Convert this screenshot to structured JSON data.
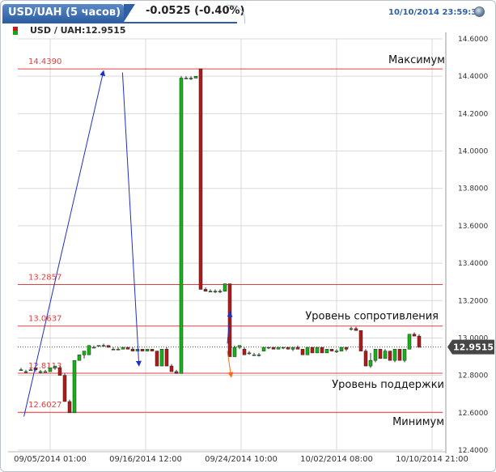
{
  "header": {
    "tab_title": "USD/UAH (5 часов)",
    "change": "-0.0525 (-0.40%)",
    "datetime": "10/10/2014 23:59:35"
  },
  "chart_data": {
    "type": "candlestick",
    "instrument_label": "USD / UAH:12.9515",
    "last_price": 12.9515,
    "last_price_label": "12.9515",
    "ylim": [
      12.4,
      14.6
    ],
    "y_ticks": [
      "14.6000",
      "14.4000",
      "14.2000",
      "14.0000",
      "13.8000",
      "13.6000",
      "13.4000",
      "13.2000",
      "13.0000",
      "12.8000",
      "12.6000",
      "12.4000"
    ],
    "x_ticks": [
      "09/05/2014 01:00",
      "09/16/2014 12:00",
      "09/24/2014 10:00",
      "10/02/2014 08:00",
      "10/10/2014 21:00"
    ],
    "levels": [
      {
        "value": 14.439,
        "label": "14.4390"
      },
      {
        "value": 13.2857,
        "label": "13.2857"
      },
      {
        "value": 13.0637,
        "label": "13.0637"
      },
      {
        "value": 12.8113,
        "label": "12.8113"
      },
      {
        "value": 12.6027,
        "label": "12.6027"
      }
    ],
    "annotations": {
      "max": "Максимум",
      "resistance": "Уровень сопротивления",
      "support": "Уровень поддержки",
      "min": "Минимум"
    },
    "candles": [
      {
        "o": 12.83,
        "h": 12.84,
        "l": 12.83,
        "c": 12.83
      },
      {
        "o": 12.82,
        "h": 12.83,
        "l": 12.81,
        "c": 12.82
      },
      {
        "o": 12.83,
        "h": 12.84,
        "l": 12.83,
        "c": 12.83
      },
      {
        "o": 12.84,
        "h": 12.84,
        "l": 12.82,
        "c": 12.83
      },
      {
        "o": 12.82,
        "h": 12.83,
        "l": 12.81,
        "c": 12.82
      },
      {
        "o": 12.82,
        "h": 12.83,
        "l": 12.82,
        "c": 12.82
      },
      {
        "o": 12.82,
        "h": 12.84,
        "l": 12.82,
        "c": 12.84
      },
      {
        "o": 12.84,
        "h": 12.85,
        "l": 12.83,
        "c": 12.85
      },
      {
        "o": 12.84,
        "h": 12.85,
        "l": 12.8,
        "c": 12.8
      },
      {
        "o": 12.8,
        "h": 12.81,
        "l": 12.66,
        "c": 12.66
      },
      {
        "o": 12.66,
        "h": 12.67,
        "l": 12.6,
        "c": 12.6
      },
      {
        "o": 12.6,
        "h": 12.88,
        "l": 12.6,
        "c": 12.88
      },
      {
        "o": 12.88,
        "h": 12.91,
        "l": 12.88,
        "c": 12.91
      },
      {
        "o": 12.91,
        "h": 12.93,
        "l": 12.89,
        "c": 12.93
      },
      {
        "o": 12.91,
        "h": 12.96,
        "l": 12.91,
        "c": 12.96
      },
      {
        "o": 12.95,
        "h": 12.96,
        "l": 12.95,
        "c": 12.95
      },
      {
        "o": 12.96,
        "h": 12.96,
        "l": 12.96,
        "c": 12.96
      },
      {
        "o": 12.96,
        "h": 12.97,
        "l": 12.96,
        "c": 12.96
      },
      {
        "o": 12.96,
        "h": 12.96,
        "l": 12.95,
        "c": 12.95
      },
      {
        "o": 12.94,
        "h": 12.95,
        "l": 12.94,
        "c": 12.94
      },
      {
        "o": 12.94,
        "h": 12.95,
        "l": 12.94,
        "c": 12.94
      },
      {
        "o": 12.94,
        "h": 12.95,
        "l": 12.94,
        "c": 12.95
      },
      {
        "o": 12.95,
        "h": 12.95,
        "l": 12.94,
        "c": 12.94
      },
      {
        "o": 12.94,
        "h": 12.95,
        "l": 12.93,
        "c": 12.93
      },
      {
        "o": 12.93,
        "h": 12.94,
        "l": 12.93,
        "c": 12.94
      },
      {
        "o": 12.94,
        "h": 12.94,
        "l": 12.93,
        "c": 12.93
      },
      {
        "o": 12.93,
        "h": 12.94,
        "l": 12.93,
        "c": 12.94
      },
      {
        "o": 12.94,
        "h": 12.94,
        "l": 12.93,
        "c": 12.93
      },
      {
        "o": 12.93,
        "h": 12.93,
        "l": 12.85,
        "c": 12.85
      },
      {
        "o": 12.85,
        "h": 12.94,
        "l": 12.85,
        "c": 12.94
      },
      {
        "o": 12.94,
        "h": 12.95,
        "l": 12.85,
        "c": 12.85
      },
      {
        "o": 12.85,
        "h": 12.86,
        "l": 12.82,
        "c": 12.82
      },
      {
        "o": 12.82,
        "h": 12.83,
        "l": 12.81,
        "c": 12.81
      },
      {
        "o": 12.81,
        "h": 14.4,
        "l": 12.81,
        "c": 14.39
      },
      {
        "o": 14.39,
        "h": 14.4,
        "l": 14.39,
        "c": 14.39
      },
      {
        "o": 14.39,
        "h": 14.4,
        "l": 14.38,
        "c": 14.39
      },
      {
        "o": 14.39,
        "h": 14.4,
        "l": 14.39,
        "c": 14.4
      },
      {
        "o": 14.44,
        "h": 14.44,
        "l": 13.26,
        "c": 13.26
      },
      {
        "o": 13.26,
        "h": 13.27,
        "l": 13.25,
        "c": 13.25
      },
      {
        "o": 13.25,
        "h": 13.26,
        "l": 13.25,
        "c": 13.25
      },
      {
        "o": 13.25,
        "h": 13.26,
        "l": 13.24,
        "c": 13.25
      },
      {
        "o": 13.25,
        "h": 13.26,
        "l": 13.24,
        "c": 13.25
      },
      {
        "o": 13.25,
        "h": 13.29,
        "l": 13.25,
        "c": 13.29
      },
      {
        "o": 13.29,
        "h": 13.29,
        "l": 12.9,
        "c": 12.9
      },
      {
        "o": 12.9,
        "h": 12.96,
        "l": 12.9,
        "c": 12.95
      },
      {
        "o": 12.95,
        "h": 12.96,
        "l": 12.94,
        "c": 12.96
      },
      {
        "o": 12.94,
        "h": 12.95,
        "l": 12.91,
        "c": 12.91
      },
      {
        "o": 12.92,
        "h": 12.93,
        "l": 12.91,
        "c": 12.92
      },
      {
        "o": 12.91,
        "h": 12.92,
        "l": 12.91,
        "c": 12.91
      },
      {
        "o": 12.91,
        "h": 12.92,
        "l": 12.9,
        "c": 12.91
      },
      {
        "o": 12.93,
        "h": 12.95,
        "l": 12.93,
        "c": 12.95
      },
      {
        "o": 12.95,
        "h": 12.95,
        "l": 12.94,
        "c": 12.95
      },
      {
        "o": 12.95,
        "h": 12.95,
        "l": 12.94,
        "c": 12.94
      },
      {
        "o": 12.94,
        "h": 12.95,
        "l": 12.94,
        "c": 12.95
      },
      {
        "o": 12.95,
        "h": 12.95,
        "l": 12.94,
        "c": 12.95
      },
      {
        "o": 12.95,
        "h": 12.95,
        "l": 12.94,
        "c": 12.94
      },
      {
        "o": 12.94,
        "h": 12.95,
        "l": 12.93,
        "c": 12.95
      },
      {
        "o": 12.95,
        "h": 12.96,
        "l": 12.94,
        "c": 12.94
      },
      {
        "o": 12.94,
        "h": 12.94,
        "l": 12.91,
        "c": 12.91
      },
      {
        "o": 12.91,
        "h": 12.95,
        "l": 12.91,
        "c": 12.95
      },
      {
        "o": 12.95,
        "h": 12.95,
        "l": 12.92,
        "c": 12.92
      },
      {
        "o": 12.92,
        "h": 12.95,
        "l": 12.92,
        "c": 12.95
      },
      {
        "o": 12.95,
        "h": 12.95,
        "l": 12.92,
        "c": 12.92
      },
      {
        "o": 12.92,
        "h": 12.94,
        "l": 12.92,
        "c": 12.94
      },
      {
        "o": 12.94,
        "h": 12.94,
        "l": 12.93,
        "c": 12.93
      },
      {
        "o": 12.93,
        "h": 12.94,
        "l": 12.92,
        "c": 12.93
      },
      {
        "o": 12.93,
        "h": 12.95,
        "l": 12.93,
        "c": 12.95
      },
      {
        "o": 12.95,
        "h": 12.95,
        "l": 12.93,
        "c": 12.94
      },
      {
        "o": 13.05,
        "h": 13.06,
        "l": 13.04,
        "c": 13.05
      },
      {
        "o": 13.05,
        "h": 13.06,
        "l": 13.04,
        "c": 13.04
      },
      {
        "o": 13.04,
        "h": 13.04,
        "l": 12.93,
        "c": 12.93
      },
      {
        "o": 12.93,
        "h": 12.94,
        "l": 12.85,
        "c": 12.85
      },
      {
        "o": 12.85,
        "h": 12.92,
        "l": 12.84,
        "c": 12.88
      },
      {
        "o": 12.88,
        "h": 12.94,
        "l": 12.87,
        "c": 12.94
      },
      {
        "o": 12.94,
        "h": 12.94,
        "l": 12.89,
        "c": 12.89
      },
      {
        "o": 12.89,
        "h": 12.94,
        "l": 12.89,
        "c": 12.93
      },
      {
        "o": 12.93,
        "h": 12.93,
        "l": 12.88,
        "c": 12.88
      },
      {
        "o": 12.88,
        "h": 12.94,
        "l": 12.87,
        "c": 12.94
      },
      {
        "o": 12.94,
        "h": 12.94,
        "l": 12.88,
        "c": 12.88
      },
      {
        "o": 12.88,
        "h": 12.94,
        "l": 12.87,
        "c": 12.94
      },
      {
        "o": 12.94,
        "h": 13.02,
        "l": 12.94,
        "c": 13.02
      },
      {
        "o": 13.02,
        "h": 13.03,
        "l": 13.01,
        "c": 13.01
      },
      {
        "o": 13.01,
        "h": 13.02,
        "l": 12.95,
        "c": 12.95
      }
    ],
    "arrows": [
      {
        "from": [
          0.6,
          12.58
        ],
        "to": [
          17.0,
          14.43
        ]
      },
      {
        "from": [
          20.9,
          14.42
        ],
        "to": [
          24.3,
          12.85
        ]
      },
      {
        "from": [
          42.5,
          12.97
        ],
        "to": [
          43.1,
          13.14
        ]
      },
      {
        "from": [
          42.5,
          12.93
        ],
        "to": [
          43.3,
          12.79
        ]
      }
    ],
    "colors": {
      "up": "#13b413",
      "down": "#b01a1a",
      "level": "#e04040",
      "arrow": "#1f2fcf",
      "arrow_down_alt": "#ff6a1a",
      "last_box": "#464646",
      "grid": "#d9d9d9"
    }
  }
}
